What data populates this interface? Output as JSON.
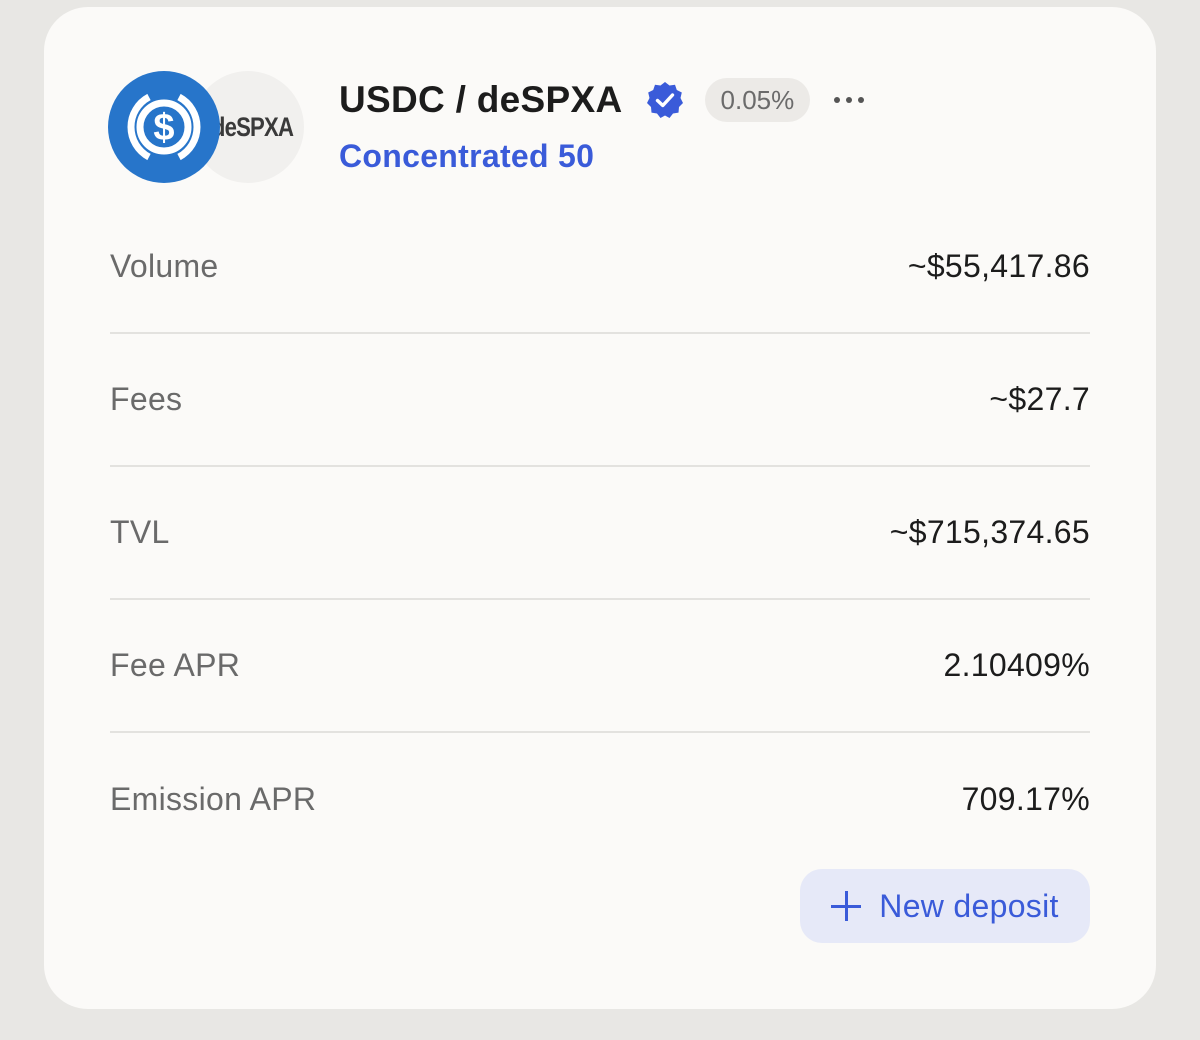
{
  "pool": {
    "title": "USDC / deSPXA",
    "token_a": "USDC",
    "token_b_logo_text": "deSPXA",
    "fee_tier": "0.05%",
    "type": "Concentrated 50",
    "verified": true
  },
  "stats": [
    {
      "label": "Volume",
      "value": "~$55,417.86"
    },
    {
      "label": "Fees",
      "value": "~$27.7"
    },
    {
      "label": "TVL",
      "value": "~$715,374.65"
    },
    {
      "label": "Fee APR",
      "value": "2.10409%"
    },
    {
      "label": "Emission APR",
      "value": "709.17%"
    }
  ],
  "actions": {
    "new_deposit_label": "New deposit"
  },
  "icons": {
    "usdc_logo": "usdc-coin-icon",
    "token_b_logo": "despxa-token-icon",
    "verified": "verified-badge-icon",
    "more": "more-horizontal-icon",
    "plus": "plus-icon"
  },
  "colors": {
    "accent": "#3a5bd9",
    "usdc_blue": "#2775ca",
    "card_bg": "#fbfaf8",
    "page_bg": "#e8e7e4",
    "button_bg": "#e6e9f8"
  }
}
